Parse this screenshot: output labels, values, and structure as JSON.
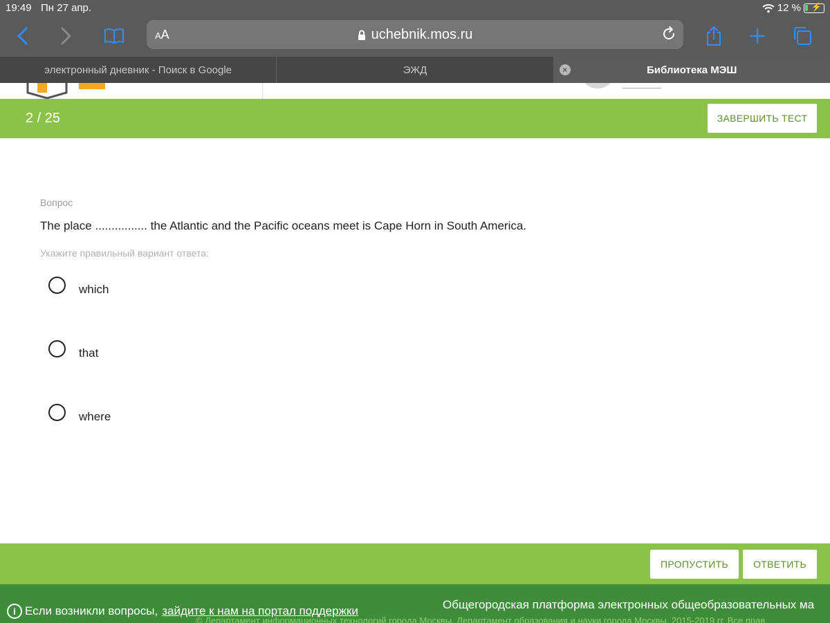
{
  "status_bar": {
    "time": "19:49",
    "date": "Пн 27 апр.",
    "battery_percent": "12 %"
  },
  "browser": {
    "aa_label_small": "A",
    "aa_label_large": "A",
    "url": "uchebnik.mos.ru",
    "tabs": [
      {
        "label": "электронный дневник - Поиск в Google",
        "active": false
      },
      {
        "label": "ЭЖД",
        "active": false
      },
      {
        "label": "Библиотека МЭШ",
        "active": true
      }
    ]
  },
  "test": {
    "counter": "2 / 25",
    "finish_label": "ЗАВЕРШИТЬ ТЕСТ",
    "question_label": "Вопрос",
    "question_text": "The place ................ the Atlantic and the Pacific oceans meet is Cape Horn in South America.",
    "hint": "Укажите правильный вариант ответа:",
    "options": [
      "which",
      "that",
      "where"
    ],
    "skip_label": "ПРОПУСТИТЬ",
    "answer_label": "ОТВЕТИТЬ"
  },
  "footer": {
    "info_text": "Если возникли вопросы,",
    "support_link": "зайдите к нам на портал поддержки",
    "platform_text": "Общегородская платформа электронных общеобразовательных ма",
    "copyright": "© Департамент информационных технологий города Москвы, Департамент образования и науки города Москвы, 2015-2019 гг. Все прав"
  },
  "colors": {
    "green": "#8bc34a",
    "dark_green": "#3f8d3a",
    "browser_chrome": "#5a5a5a",
    "accent_blue": "#2f8cf7"
  }
}
